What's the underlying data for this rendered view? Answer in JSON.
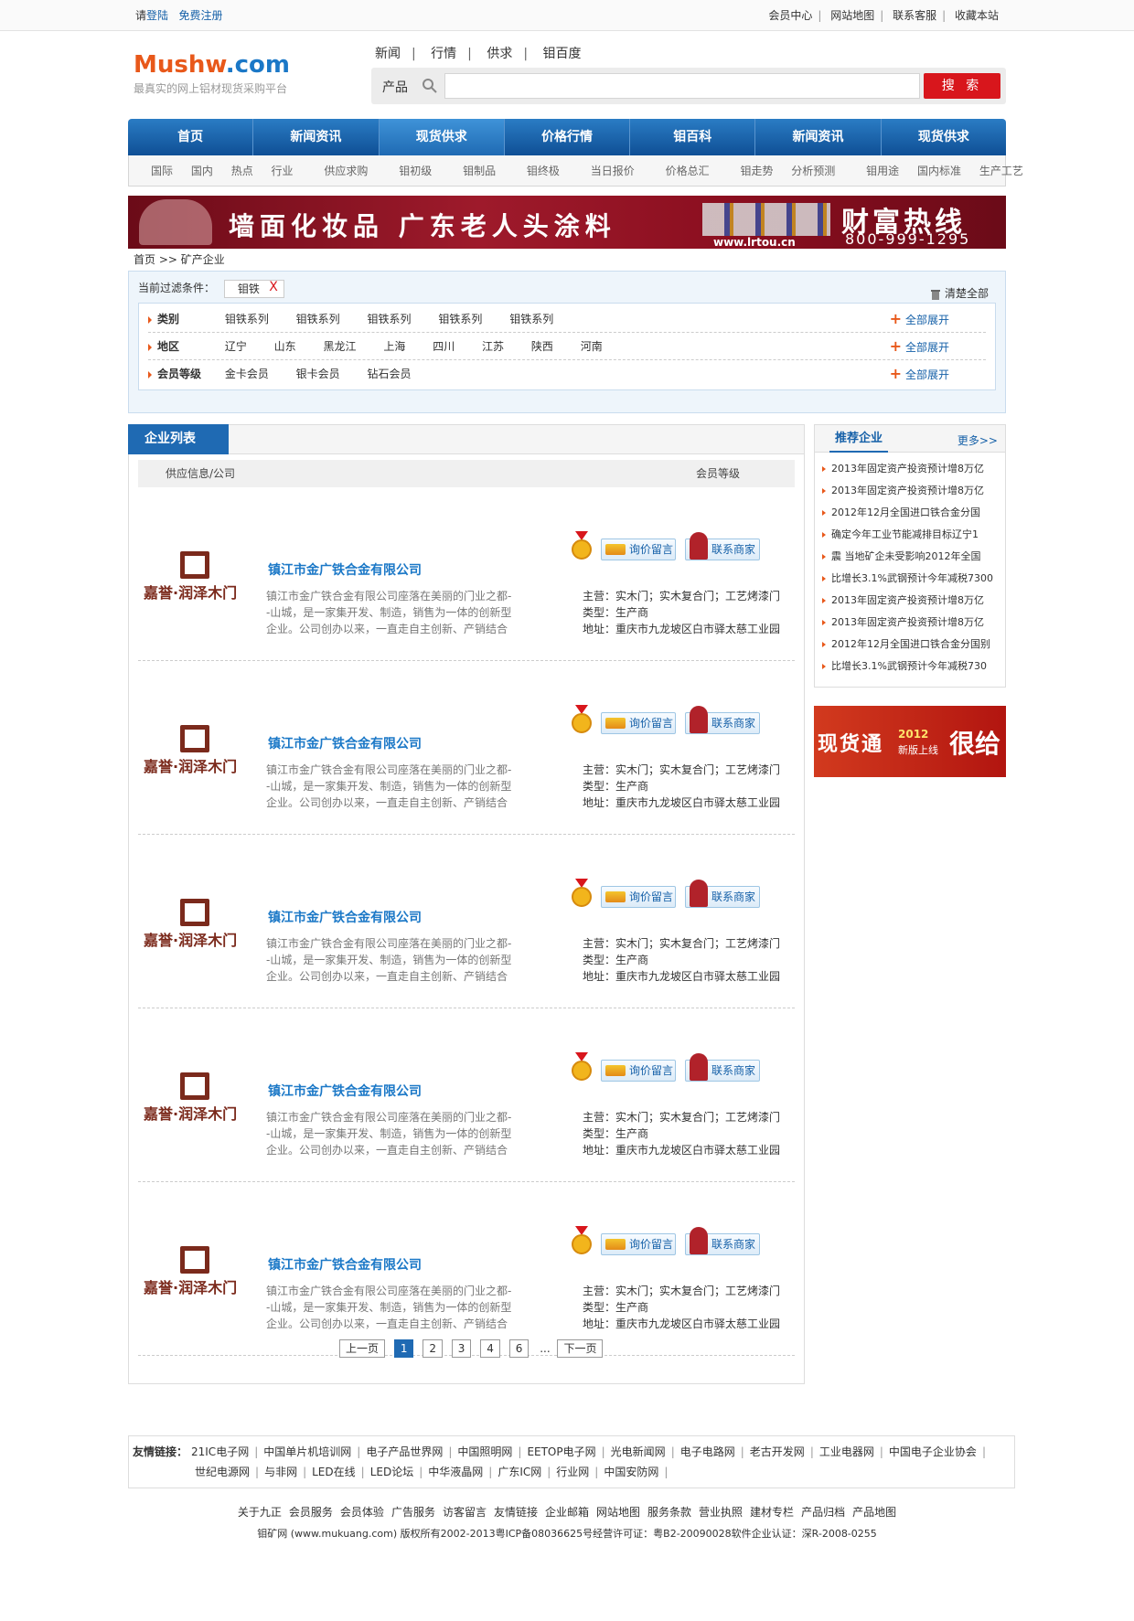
{
  "top": {
    "please": "请",
    "login": "登陆",
    "register": "免费注册",
    "links": [
      "会员中心",
      "网站地图",
      "联系客服",
      "收藏本站"
    ]
  },
  "logo": {
    "main": "Mushw",
    "tld": ".com",
    "slogan": "最真实的网上铝材现货采购平台"
  },
  "header_nav": [
    "新闻",
    "行情",
    "供求",
    "钼百度"
  ],
  "search": {
    "label": "产品",
    "placeholder": "",
    "button": "搜 索"
  },
  "main_nav": [
    "首页",
    "新闻资讯",
    "现货供求",
    "价格行情",
    "钼百科",
    "新闻资讯",
    "现货供求"
  ],
  "sub_nav": [
    "国际",
    "国内",
    "热点",
    "行业",
    "供应求购",
    "钼初级",
    "钼制品",
    "钼终极",
    "当日报价",
    "价格总汇",
    "钼走势",
    "分析预测",
    "钼用途",
    "国内标准",
    "生产工艺"
  ],
  "banner": {
    "slogan": "墙面化妆品  广东老人头涂料",
    "site": "www.lrtou.cn",
    "hotline_title": "财富热线",
    "hotline": "800-999-1295"
  },
  "breadcrumb": {
    "home": "首页",
    "sep": ">>",
    "current": "矿产企业"
  },
  "filter": {
    "current_label": "当前过滤条件：",
    "tag": "钼铁",
    "tag_close": "X",
    "clear": "清楚全部",
    "expand": "全部展开",
    "rows": [
      {
        "key": "类别",
        "values": [
          "钼铁系列",
          "钼铁系列",
          "钼铁系列",
          "钼铁系列",
          "钼铁系列"
        ]
      },
      {
        "key": "地区",
        "values": [
          "辽宁",
          "山东",
          "黑龙江",
          "上海",
          "四川",
          "江苏",
          "陕西",
          "河南"
        ]
      },
      {
        "key": "会员等级",
        "values": [
          "金卡会员",
          "银卡会员",
          "钻石会员"
        ]
      }
    ]
  },
  "list": {
    "tab": "企业列表",
    "col_company": "供应信息/公司",
    "col_level": "会员等级",
    "inquiry": "询价留言",
    "contact": "联系商家",
    "logo_text": "嘉誉·润泽木门",
    "items": [
      {
        "name": "镇江市金广铁合金有限公司",
        "desc": "镇江市金广铁合金有限公司座落在美丽的门业之都--山城，是一家集开发、制造，销售为一体的创新型企业。公司创办以来，一直走自主创新、产销结合的发展道路，逐渐...",
        "main": "主营：实木门；实木复合门；工艺烤漆门",
        "type": "类型：生产商",
        "addr": "地址：重庆市九龙坡区白市驿太慈工业园"
      },
      {
        "name": "镇江市金广铁合金有限公司",
        "desc": "镇江市金广铁合金有限公司座落在美丽的门业之都--山城，是一家集开发、制造，销售为一体的创新型企业。公司创办以来，一直走自主创新、产销结合的发展道路，逐渐...",
        "main": "主营：实木门；实木复合门；工艺烤漆门",
        "type": "类型：生产商",
        "addr": "地址：重庆市九龙坡区白市驿太慈工业园"
      },
      {
        "name": "镇江市金广铁合金有限公司",
        "desc": "镇江市金广铁合金有限公司座落在美丽的门业之都--山城，是一家集开发、制造，销售为一体的创新型企业。公司创办以来，一直走自主创新、产销结合的发展道路，逐渐...",
        "main": "主营：实木门；实木复合门；工艺烤漆门",
        "type": "类型：生产商",
        "addr": "地址：重庆市九龙坡区白市驿太慈工业园"
      },
      {
        "name": "镇江市金广铁合金有限公司",
        "desc": "镇江市金广铁合金有限公司座落在美丽的门业之都--山城，是一家集开发、制造，销售为一体的创新型企业。公司创办以来，一直走自主创新、产销结合的发展道路，逐渐...",
        "main": "主营：实木门；实木复合门；工艺烤漆门",
        "type": "类型：生产商",
        "addr": "地址：重庆市九龙坡区白市驿太慈工业园"
      },
      {
        "name": "镇江市金广铁合金有限公司",
        "desc": "镇江市金广铁合金有限公司座落在美丽的门业之都--山城，是一家集开发、制造，销售为一体的创新型企业。公司创办以来，一直走自主创新、产销结合的发展道路，逐渐...",
        "main": "主营：实木门；实木复合门；工艺烤漆门",
        "type": "类型：生产商",
        "addr": "地址：重庆市九龙坡区白市驿太慈工业园"
      }
    ]
  },
  "pager": {
    "prev": "上一页",
    "pages": [
      "1",
      "2",
      "3",
      "4",
      "6"
    ],
    "dots": "...",
    "next": "下一页",
    "current": "1"
  },
  "recommend": {
    "title": "推荐企业",
    "more": "更多>>",
    "items": [
      "2013年固定资产投资预计增8万亿",
      "2013年固定资产投资预计增8万亿",
      "2012年12月全国进口铁合金分国",
      "确定今年工业节能减排目标辽宁1",
      "震 当地矿企未受影响2012年全国",
      "比增长3.1%武钢预计今年减税7300",
      "2013年固定资产投资预计增8万亿",
      "2013年固定资产投资预计增8万亿",
      "2012年12月全国进口铁合金分国别",
      "比增长3.1%武钢预计今年减税730"
    ]
  },
  "side_ad": {
    "a": "现货通",
    "b": "2012",
    "c": "新版上线",
    "d": "很给"
  },
  "friend_links": {
    "label": "友情链接：",
    "row1": [
      "21IC电子网",
      "中国单片机培训网",
      "电子产品世界网",
      "中国照明网",
      "EETOP电子网",
      "光电新闻网",
      "电子电路网",
      "老古开发网",
      "工业电器网",
      "中国电子企业协会"
    ],
    "row2": [
      "世纪电源网",
      "与非网",
      "LED在线",
      "LED论坛",
      "中华液晶网",
      "广东IC网",
      "行业网",
      "中国安防网"
    ]
  },
  "footer": {
    "links": [
      "关于九正",
      "会员服务",
      "会员体验",
      "广告服务",
      "访客留言",
      "友情链接",
      "企业邮箱",
      "网站地图",
      "服务条款",
      "营业执照",
      "建材专栏",
      "产品归档",
      "产品地图"
    ],
    "copyright": "钼矿网 (www.mukuang.com) 版权所有2002-2013粤ICP备08036625号经营许可证：粤B2-20090028软件企业认证：深R-2008-0255"
  }
}
